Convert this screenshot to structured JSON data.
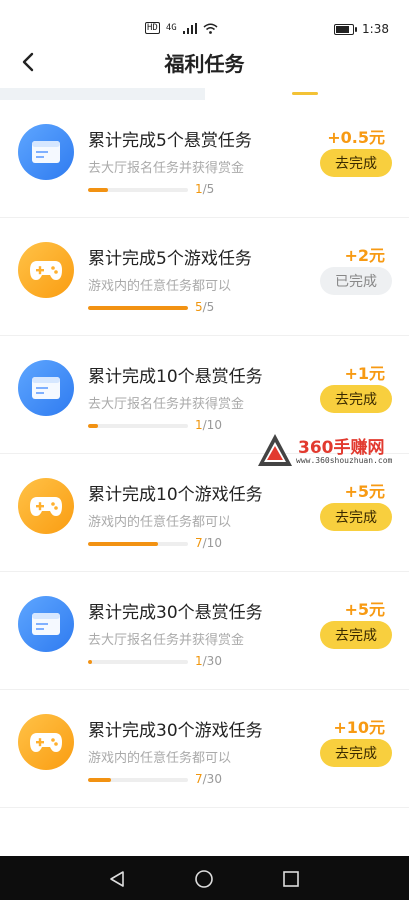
{
  "status_bar": {
    "hd_label": "HD",
    "network_label": "4G",
    "time": "1:38"
  },
  "header": {
    "title": "福利任务",
    "back_icon": "chevron-left-icon"
  },
  "colors": {
    "accent_orange": "#f79a13",
    "button_yellow": "#f8cf3e",
    "icon_blue": "#2f7bf0",
    "icon_orange": "#fa9d12"
  },
  "tasks": [
    {
      "prefix": "累计完成",
      "num": "5",
      "suffix": "个悬赏任务",
      "desc": "去大厅报名任务并获得赏金",
      "progress_current": "1",
      "progress_total": "/5",
      "progress_fraction": 0.2,
      "reward": "+0.5元",
      "button_label": "去完成",
      "icon": "window-icon",
      "done": false
    },
    {
      "prefix": "累计完成",
      "num": "5",
      "suffix": "个游戏任务",
      "desc": "游戏内的任意任务都可以",
      "progress_current": "5",
      "progress_total": "/5",
      "progress_fraction": 1.0,
      "reward": "+2元",
      "button_label": "已完成",
      "icon": "gamepad-icon",
      "done": true
    },
    {
      "prefix": "累计完成",
      "num": "10",
      "suffix": "个悬赏任务",
      "desc": "去大厅报名任务并获得赏金",
      "progress_current": "1",
      "progress_total": "/10",
      "progress_fraction": 0.1,
      "reward": "+1元",
      "button_label": "去完成",
      "icon": "window-icon",
      "done": false
    },
    {
      "prefix": "累计完成",
      "num": "10",
      "suffix": "个游戏任务",
      "desc": "游戏内的任意任务都可以",
      "progress_current": "7",
      "progress_total": "/10",
      "progress_fraction": 0.7,
      "reward": "+5元",
      "button_label": "去完成",
      "icon": "gamepad-icon",
      "done": false
    },
    {
      "prefix": "累计完成",
      "num": "30",
      "suffix": "个悬赏任务",
      "desc": "去大厅报名任务并获得赏金",
      "progress_current": "1",
      "progress_total": "/30",
      "progress_fraction": 0.033,
      "reward": "+5元",
      "button_label": "去完成",
      "icon": "window-icon",
      "done": false
    },
    {
      "prefix": "累计完成",
      "num": "30",
      "suffix": "个游戏任务",
      "desc": "游戏内的任意任务都可以",
      "progress_current": "7",
      "progress_total": "/30",
      "progress_fraction": 0.233,
      "reward": "+10元",
      "button_label": "去完成",
      "icon": "gamepad-icon",
      "done": false
    }
  ],
  "watermark": {
    "text": "360手赚网",
    "url": "www.360shouzhuan.com"
  },
  "nav_bar": {
    "icons": [
      "back-triangle-icon",
      "home-circle-icon",
      "recents-square-icon"
    ]
  }
}
